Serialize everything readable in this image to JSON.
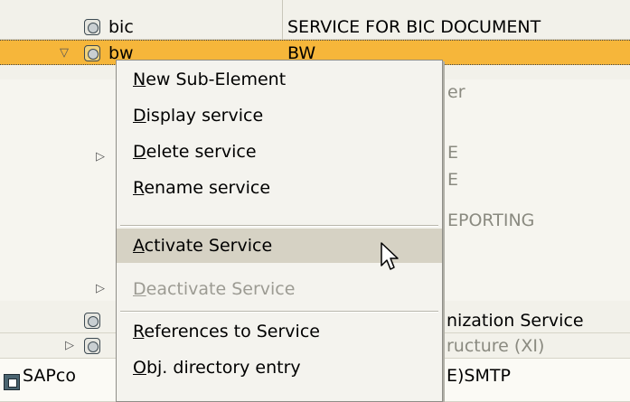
{
  "tree": {
    "row_bic": {
      "name": "bic",
      "description": "SERVICE FOR BIC DOCUMENT"
    },
    "row_bw": {
      "name": "bw",
      "description": "BW"
    },
    "behind_texts": [
      "er",
      "E",
      "E",
      "EPORTING"
    ],
    "row_org": {
      "description": "nization Service"
    },
    "row_xi": {
      "description": "ructure (XI)"
    },
    "row_sap": {
      "name": "SAPco",
      "description": "E)SMTP"
    }
  },
  "context_menu": {
    "items": [
      {
        "key": "N",
        "rest": "ew Sub-Element"
      },
      {
        "key": "D",
        "rest": "isplay service"
      },
      {
        "key": "D",
        "rest": "elete service"
      },
      {
        "key": "R",
        "rest": "ename service"
      },
      {
        "key": "A",
        "rest": "ctivate Service"
      },
      {
        "key": "D",
        "rest": "eactivate Service"
      },
      {
        "key": "R",
        "rest": "eferences to Service"
      },
      {
        "key": "O",
        "rest": "bj. directory entry"
      }
    ]
  },
  "icons": {
    "service": "service-node-icon",
    "expand": "expand-triangle-icon",
    "collapse": "collapse-triangle-icon",
    "sap": "sap-node-icon",
    "cursor": "mouse-cursor-icon"
  },
  "colors": {
    "selection": "#f6b63a",
    "menu_hover": "#d6d2c4",
    "disabled_text": "#9c9b93"
  }
}
